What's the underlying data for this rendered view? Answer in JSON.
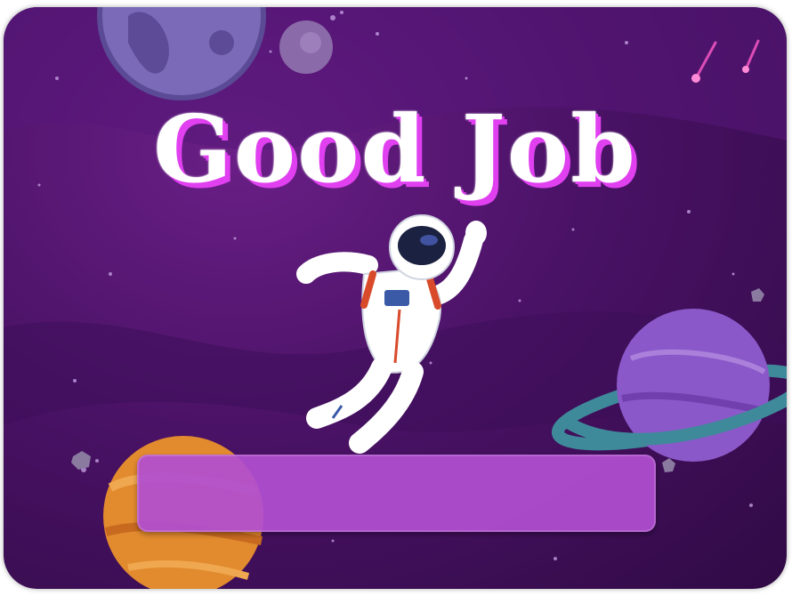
{
  "screen": {
    "title": "Good Job",
    "banner_text": ""
  },
  "colors": {
    "background": "#4a1266",
    "title_fill": "#ffffff",
    "title_shadow": "#e040f0",
    "banner": "#b24fd2"
  },
  "icons": [
    "astronaut-icon",
    "ringed-planet-icon",
    "moon-icon",
    "orange-planet-icon",
    "small-planet-icon"
  ]
}
